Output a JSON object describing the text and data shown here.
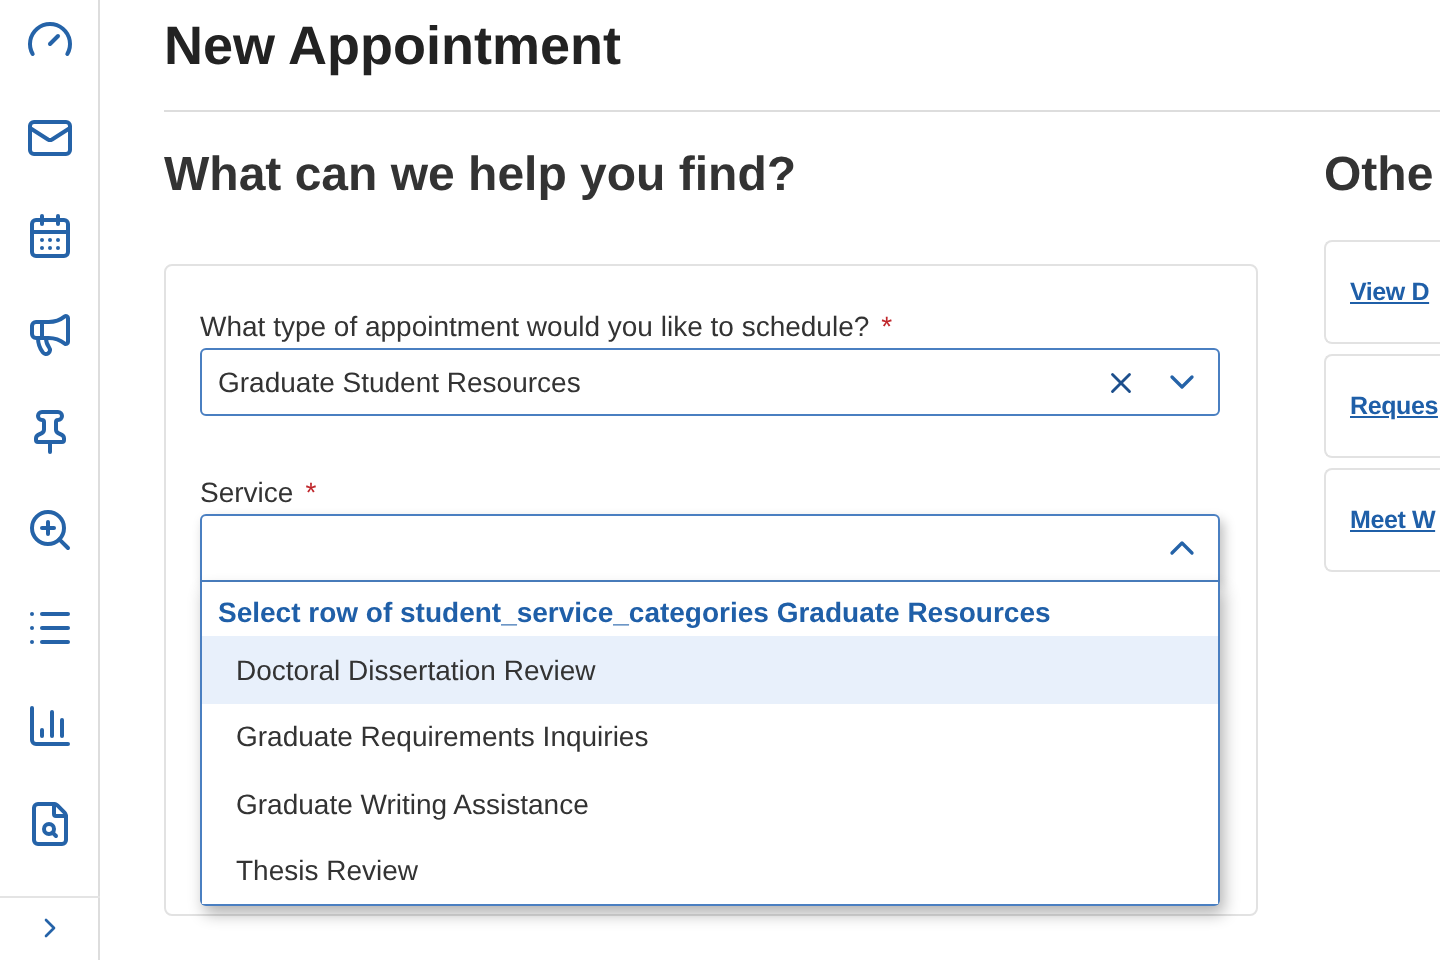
{
  "page": {
    "title": "New Appointment"
  },
  "form": {
    "heading": "What can we help you find?",
    "fields": [
      {
        "label": "What type of appointment would you like to schedule?",
        "required_mark": "*",
        "value": "Graduate Student Resources",
        "expanded": false
      },
      {
        "label": "Service",
        "required_mark": "*",
        "expanded": true,
        "dropdown": {
          "header": "Select row of student_service_categories Graduate Resources",
          "options": [
            {
              "label": "Doctoral Dissertation Review",
              "selected": true
            },
            {
              "label": "Graduate Requirements Inquiries",
              "selected": false
            },
            {
              "label": "Graduate Writing Assistance",
              "selected": false
            },
            {
              "label": "Thesis Review",
              "selected": false
            }
          ]
        }
      }
    ]
  },
  "other": {
    "heading": "Othe",
    "links": [
      "View D",
      "Reques",
      "Meet W"
    ]
  }
}
